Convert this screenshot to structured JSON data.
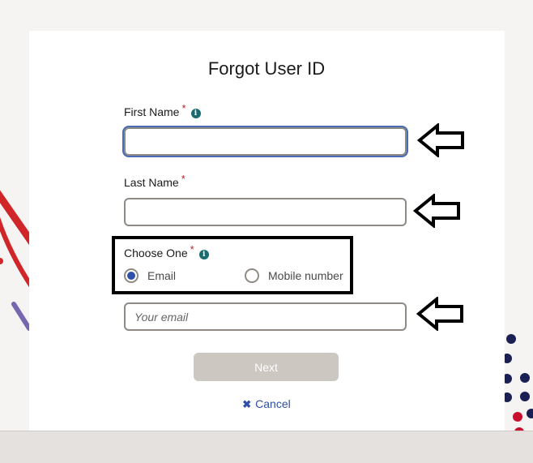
{
  "title": "Forgot User ID",
  "fields": {
    "first_name": {
      "label": "First Name",
      "required_mark": "*",
      "value": "",
      "has_info": true
    },
    "last_name": {
      "label": "Last Name",
      "required_mark": "*",
      "value": ""
    },
    "choose_one": {
      "label": "Choose One",
      "required_mark": "*",
      "options": [
        {
          "label": "Email",
          "selected": true
        },
        {
          "label": "Mobile number",
          "selected": false
        }
      ]
    },
    "email": {
      "value": "",
      "placeholder": "Your email"
    }
  },
  "icons": {
    "info": "i",
    "cancel": "✖"
  },
  "buttons": {
    "next_label": "Next",
    "cancel_label": "Cancel"
  },
  "colors": {
    "accent": "#2f4fa8",
    "required": "#b0262d",
    "info": "#1c6b72",
    "disabled_button": "#ccc7c1"
  }
}
